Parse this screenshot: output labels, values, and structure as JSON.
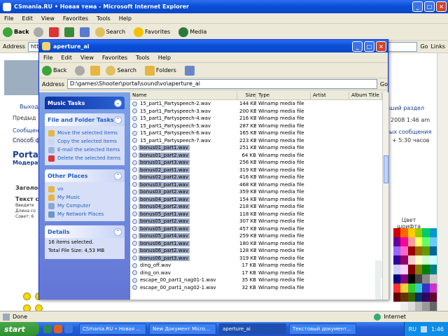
{
  "ie": {
    "title": "CSmania.RU • Новая тема - Microsoft Internet Explorer",
    "menu": [
      "File",
      "Edit",
      "View",
      "Favorites",
      "Tools",
      "Help"
    ],
    "toolbar": {
      "back": "Back",
      "search": "Search",
      "favorites": "Favorites",
      "media": "Media"
    },
    "address_label": "Address",
    "address_value": "htt",
    "go": "Go",
    "links": "Links",
    "status_left": "Done",
    "status_right": "Internet",
    "page_texts": {
      "portal": "Portal",
      "moderator": "Модерат",
      "exit": "Выход",
      "prev": "Предыд",
      "messages": "Сообщени",
      "method": "Способ ф",
      "header": "Заголов",
      "text": "Текст с",
      "enter": "Введите",
      "length": "Длина со",
      "advice": "Совет: 6",
      "section": "ший раздел",
      "date": "2008 1:46 am",
      "pm": "ых сообщения",
      "tz": "+ 5:30 часов",
      "color": "Цвет шрифта"
    },
    "palette_colors": [
      "#cc0000",
      "#ff6600",
      "#ffcc00",
      "#99cc00",
      "#00cc66",
      "#0099cc",
      "#660099",
      "#ff0099",
      "#ff9999",
      "#ffff66",
      "#66ff66",
      "#66ccff",
      "#9966ff",
      "#ff66cc",
      "#990000",
      "#996600",
      "#669900",
      "#006699",
      "#330099",
      "#990066",
      "#ffcccc",
      "#ffffcc",
      "#ccffcc",
      "#ccffff",
      "#ccccff",
      "#ffccff",
      "#800000",
      "#808000",
      "#008000",
      "#008080",
      "#000080",
      "#800080",
      "#000000",
      "#444444",
      "#888888",
      "#cccccc",
      "#ff3333",
      "#ffcc33",
      "#33cc33",
      "#33cccc",
      "#3333cc",
      "#cc33cc",
      "#660000",
      "#663300",
      "#336600",
      "#003366",
      "#330066",
      "#660033",
      "#ffffff",
      "#eeeeee",
      "#dddddd",
      "#bbbbbb",
      "#999999",
      "#666666"
    ]
  },
  "explorer": {
    "title": "aperture_ai",
    "menu": [
      "File",
      "Edit",
      "View",
      "Favorites",
      "Tools",
      "Help"
    ],
    "toolbar": {
      "back": "Back",
      "search": "Search",
      "folders": "Folders"
    },
    "address_label": "Address",
    "address_value": "D:\\games\\Shooter\\portal\\sound\\vo\\aperture_ai",
    "go": "Go",
    "music_tasks": "Music Tasks",
    "file_tasks": {
      "title": "File and Folder Tasks",
      "items": [
        "Move the selected items",
        "Copy the selected items",
        "E-mail the selected items",
        "Delete the selected items"
      ]
    },
    "other_places": {
      "title": "Other Places",
      "items": [
        "vo",
        "My Music",
        "My Computer",
        "My Network Places"
      ]
    },
    "details": {
      "title": "Details",
      "count": "16 items selected.",
      "size": "Total File Size: 4,53 MB"
    },
    "columns": [
      "Name",
      "Size",
      "Type",
      "Artist",
      "Album Title"
    ],
    "files": [
      {
        "name": "15_part1_Partyspeech-2.wav",
        "size": "144 KB",
        "type": "Winamp media file",
        "selected": false
      },
      {
        "name": "15_part1_Partyspeech-3.wav",
        "size": "200 KB",
        "type": "Winamp media file",
        "selected": false
      },
      {
        "name": "15_part1_Partyspeech-4.wav",
        "size": "216 KB",
        "type": "Winamp media file",
        "selected": false
      },
      {
        "name": "15_part1_Partyspeech-5.wav",
        "size": "287 KB",
        "type": "Winamp media file",
        "selected": false
      },
      {
        "name": "15_part1_Partyspeech-6.wav",
        "size": "165 KB",
        "type": "Winamp media file",
        "selected": false
      },
      {
        "name": "15_part1_Partyspeech-7.wav",
        "size": "223 KB",
        "type": "Winamp media file",
        "selected": false
      },
      {
        "name": "bonus01_part1.wav",
        "size": "251 KB",
        "type": "Winamp media file",
        "selected": true
      },
      {
        "name": "bonus01_part2.wav",
        "size": "64 KB",
        "type": "Winamp media file",
        "selected": true
      },
      {
        "name": "bonus01_part3.wav",
        "size": "256 KB",
        "type": "Winamp media file",
        "selected": true
      },
      {
        "name": "bonus02_part1.wav",
        "size": "319 KB",
        "type": "Winamp media file",
        "selected": true
      },
      {
        "name": "bonus02_part2.wav",
        "size": "416 KB",
        "type": "Winamp media file",
        "selected": true
      },
      {
        "name": "bonus03_part1.wav",
        "size": "468 KB",
        "type": "Winamp media file",
        "selected": true
      },
      {
        "name": "bonus03_part2.wav",
        "size": "359 KB",
        "type": "Winamp media file",
        "selected": true
      },
      {
        "name": "bonus04_part1.wav",
        "size": "154 KB",
        "type": "Winamp media file",
        "selected": true
      },
      {
        "name": "bonus04_part2.wav",
        "size": "218 KB",
        "type": "Winamp media file",
        "selected": true
      },
      {
        "name": "bonus05_part1.wav",
        "size": "118 KB",
        "type": "Winamp media file",
        "selected": true
      },
      {
        "name": "bonus05_part2.wav",
        "size": "307 KB",
        "type": "Winamp media file",
        "selected": true
      },
      {
        "name": "bonus05_part3.wav",
        "size": "457 KB",
        "type": "Winamp media file",
        "selected": true
      },
      {
        "name": "bonus05_part4.wav",
        "size": "259 KB",
        "type": "Winamp media file",
        "selected": true
      },
      {
        "name": "bonus06_part1.wav",
        "size": "180 KB",
        "type": "Winamp media file",
        "selected": true
      },
      {
        "name": "bonus06_part2.wav",
        "size": "128 KB",
        "type": "Winamp media file",
        "selected": true
      },
      {
        "name": "bonus06_part3.wav",
        "size": "319 KB",
        "type": "Winamp media file",
        "selected": true
      },
      {
        "name": "ding_off.wav",
        "size": "17 KB",
        "type": "Winamp media file",
        "selected": false
      },
      {
        "name": "ding_on.wav",
        "size": "17 KB",
        "type": "Winamp media file",
        "selected": false
      },
      {
        "name": "escape_00_part1_nag01-1.wav",
        "size": "35 KB",
        "type": "Winamp media file",
        "selected": false
      },
      {
        "name": "escape_00_part1_nag02-1.wav",
        "size": "32 KB",
        "type": "Winamp media file",
        "selected": false
      }
    ]
  },
  "taskbar": {
    "start": "start",
    "buttons": [
      "CSmania.RU • Новая ...",
      "New Документ Micro...",
      "aperture_ai",
      "Текстовый документ..."
    ],
    "active_index": 2,
    "lang": "RU",
    "clock": "1:46"
  }
}
